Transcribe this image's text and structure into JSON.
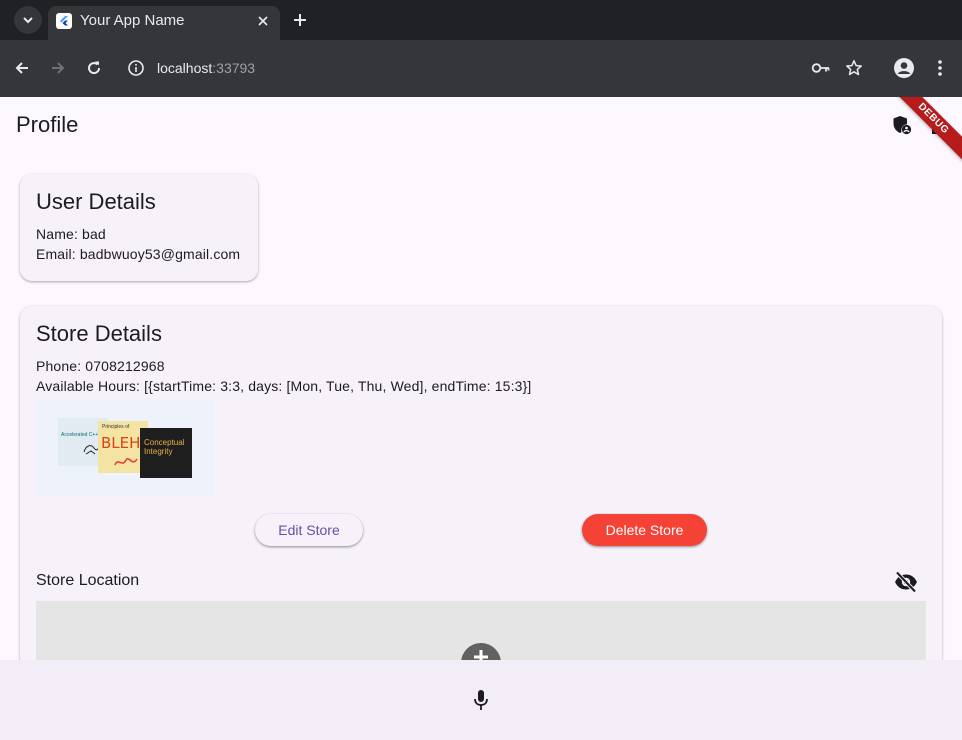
{
  "browser": {
    "tab_title": "Your App Name",
    "url_host": "localhost",
    "url_port": ":33793"
  },
  "app": {
    "title": "Profile",
    "debug_banner": "DEBUG"
  },
  "user_details": {
    "title": "User Details",
    "name_line": "Name: bad",
    "email_line": "Email: badbwuoy53@gmail.com"
  },
  "store_details": {
    "title": "Store Details",
    "phone_line": "Phone: 0708212968",
    "hours_line": "Available Hours: [{startTime: 3:3, days: [Mon, Tue, Thu, Wed], endTime: 15:3}]",
    "image_text": {
      "book1": "Accelerated C++",
      "book2_small": "Principles of",
      "book2_main": "BLEH",
      "book3_main": "Conceptual Integrity"
    },
    "edit_button": "Edit Store",
    "delete_button": "Delete Store",
    "location_label": "Store Location"
  },
  "icons": {
    "tab_list": "chevron-down-icon",
    "favicon": "flutter-icon",
    "tab_close": "close-icon",
    "new_tab": "plus-icon",
    "back": "arrow-left-icon",
    "forward": "arrow-right-icon",
    "reload": "reload-icon",
    "site_info": "info-icon",
    "password": "key-icon",
    "bookmark": "star-icon",
    "profile": "person-icon",
    "menu": "kebab-menu-icon",
    "admin": "admin-shield-icon",
    "logout": "logout-icon",
    "visibility": "visibility-off-icon",
    "map_add": "add-icon",
    "mic": "microphone-icon"
  },
  "colors": {
    "primary": "#6750a4",
    "delete": "#f44336",
    "debug_ribbon": "#b71c1c",
    "background": "#fdf7ff"
  }
}
